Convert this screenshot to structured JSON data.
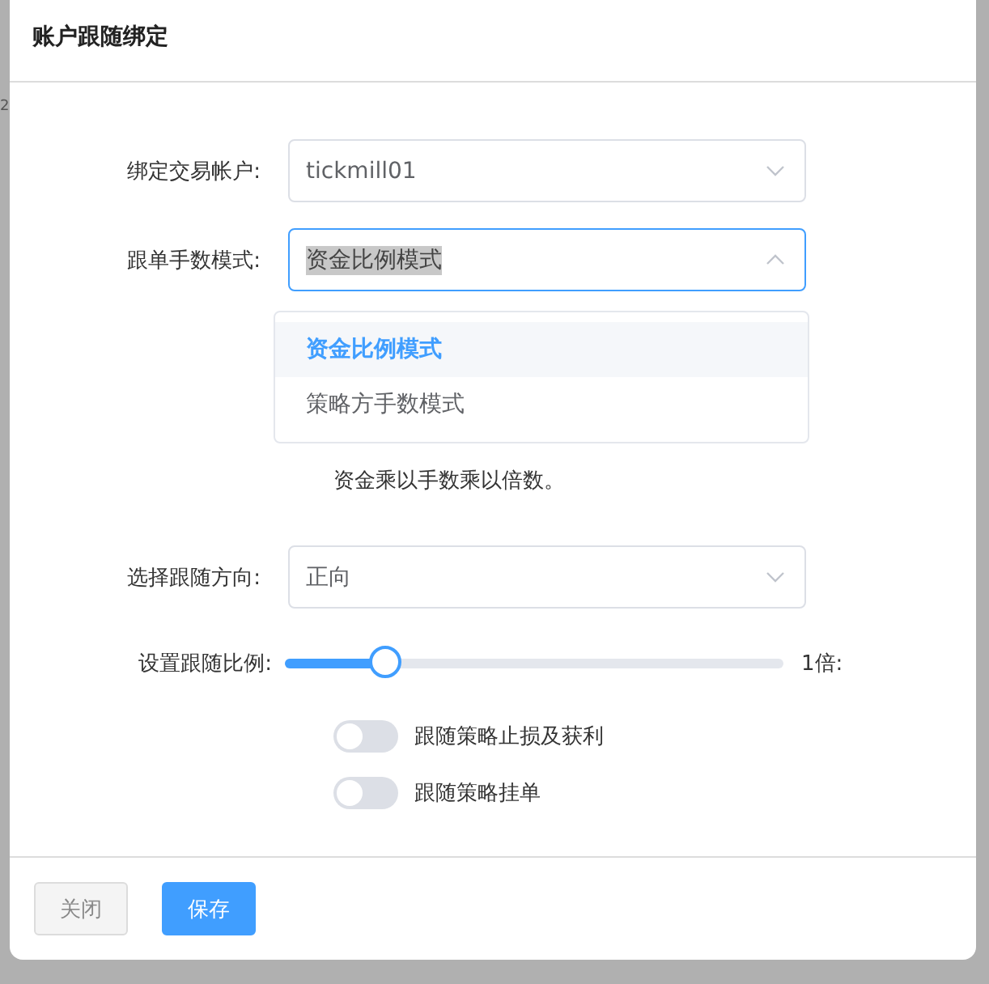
{
  "background": {
    "text": "2"
  },
  "dialog": {
    "title": "账户跟随绑定"
  },
  "fields": [
    {
      "kind": "select",
      "label": "绑定交易帐户:",
      "value": "tickmill01",
      "expanded": false
    },
    {
      "kind": "select",
      "label": "跟单手数模式:",
      "value": "资金比例模式",
      "expanded": true,
      "options": [
        {
          "label": "资金比例模式",
          "selected": true
        },
        {
          "label": "策略方手数模式",
          "selected": false
        }
      ]
    },
    {
      "kind": "note",
      "text": "资金乘以手数乘以倍数。"
    },
    {
      "kind": "select",
      "label": "选择跟随方向:",
      "value": "正向",
      "expanded": false
    },
    {
      "kind": "slider",
      "label": "设置跟随比例:",
      "level": 0.2,
      "reading": "1倍:"
    },
    {
      "kind": "switch",
      "label": "跟随策略止损及获利",
      "on": false
    },
    {
      "kind": "switch",
      "label": "跟随策略挂单",
      "on": false
    }
  ],
  "buttons": [
    {
      "label": "关闭",
      "kind": "default"
    },
    {
      "label": "保存",
      "kind": "primary"
    }
  ]
}
